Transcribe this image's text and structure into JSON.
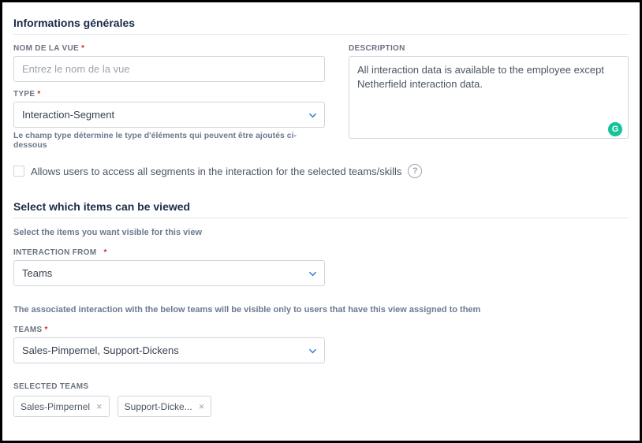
{
  "general": {
    "section_title": "Informations générales",
    "name": {
      "label": "NOM DE LA VUE",
      "placeholder": "Entrez le nom de la vue"
    },
    "type": {
      "label": "TYPE",
      "value": "Interaction-Segment",
      "hint": "Le champ type détermine le type d'éléments qui peuvent être ajoutés ci-dessous"
    },
    "description": {
      "label": "DESCRIPTION",
      "value": "All interaction data is available to the employee except Netherfield interaction data."
    }
  },
  "access_checkbox": {
    "label": "Allows users to access all segments in the interaction for the selected teams/skills"
  },
  "viewable": {
    "section_title": "Select which items can be viewed",
    "hint": "Select the items you want visible for this view",
    "interaction_from": {
      "label": "INTERACTION FROM",
      "value": "Teams"
    },
    "association_hint": "The associated interaction with the below teams will be visible only to users that have this view assigned to them",
    "teams": {
      "label": "TEAMS",
      "value": "Sales-Pimpernel, Support-Dickens"
    },
    "selected_teams": {
      "label": "SELECTED TEAMS",
      "items": [
        "Sales-Pimpernel",
        "Support-Dicke..."
      ]
    }
  }
}
